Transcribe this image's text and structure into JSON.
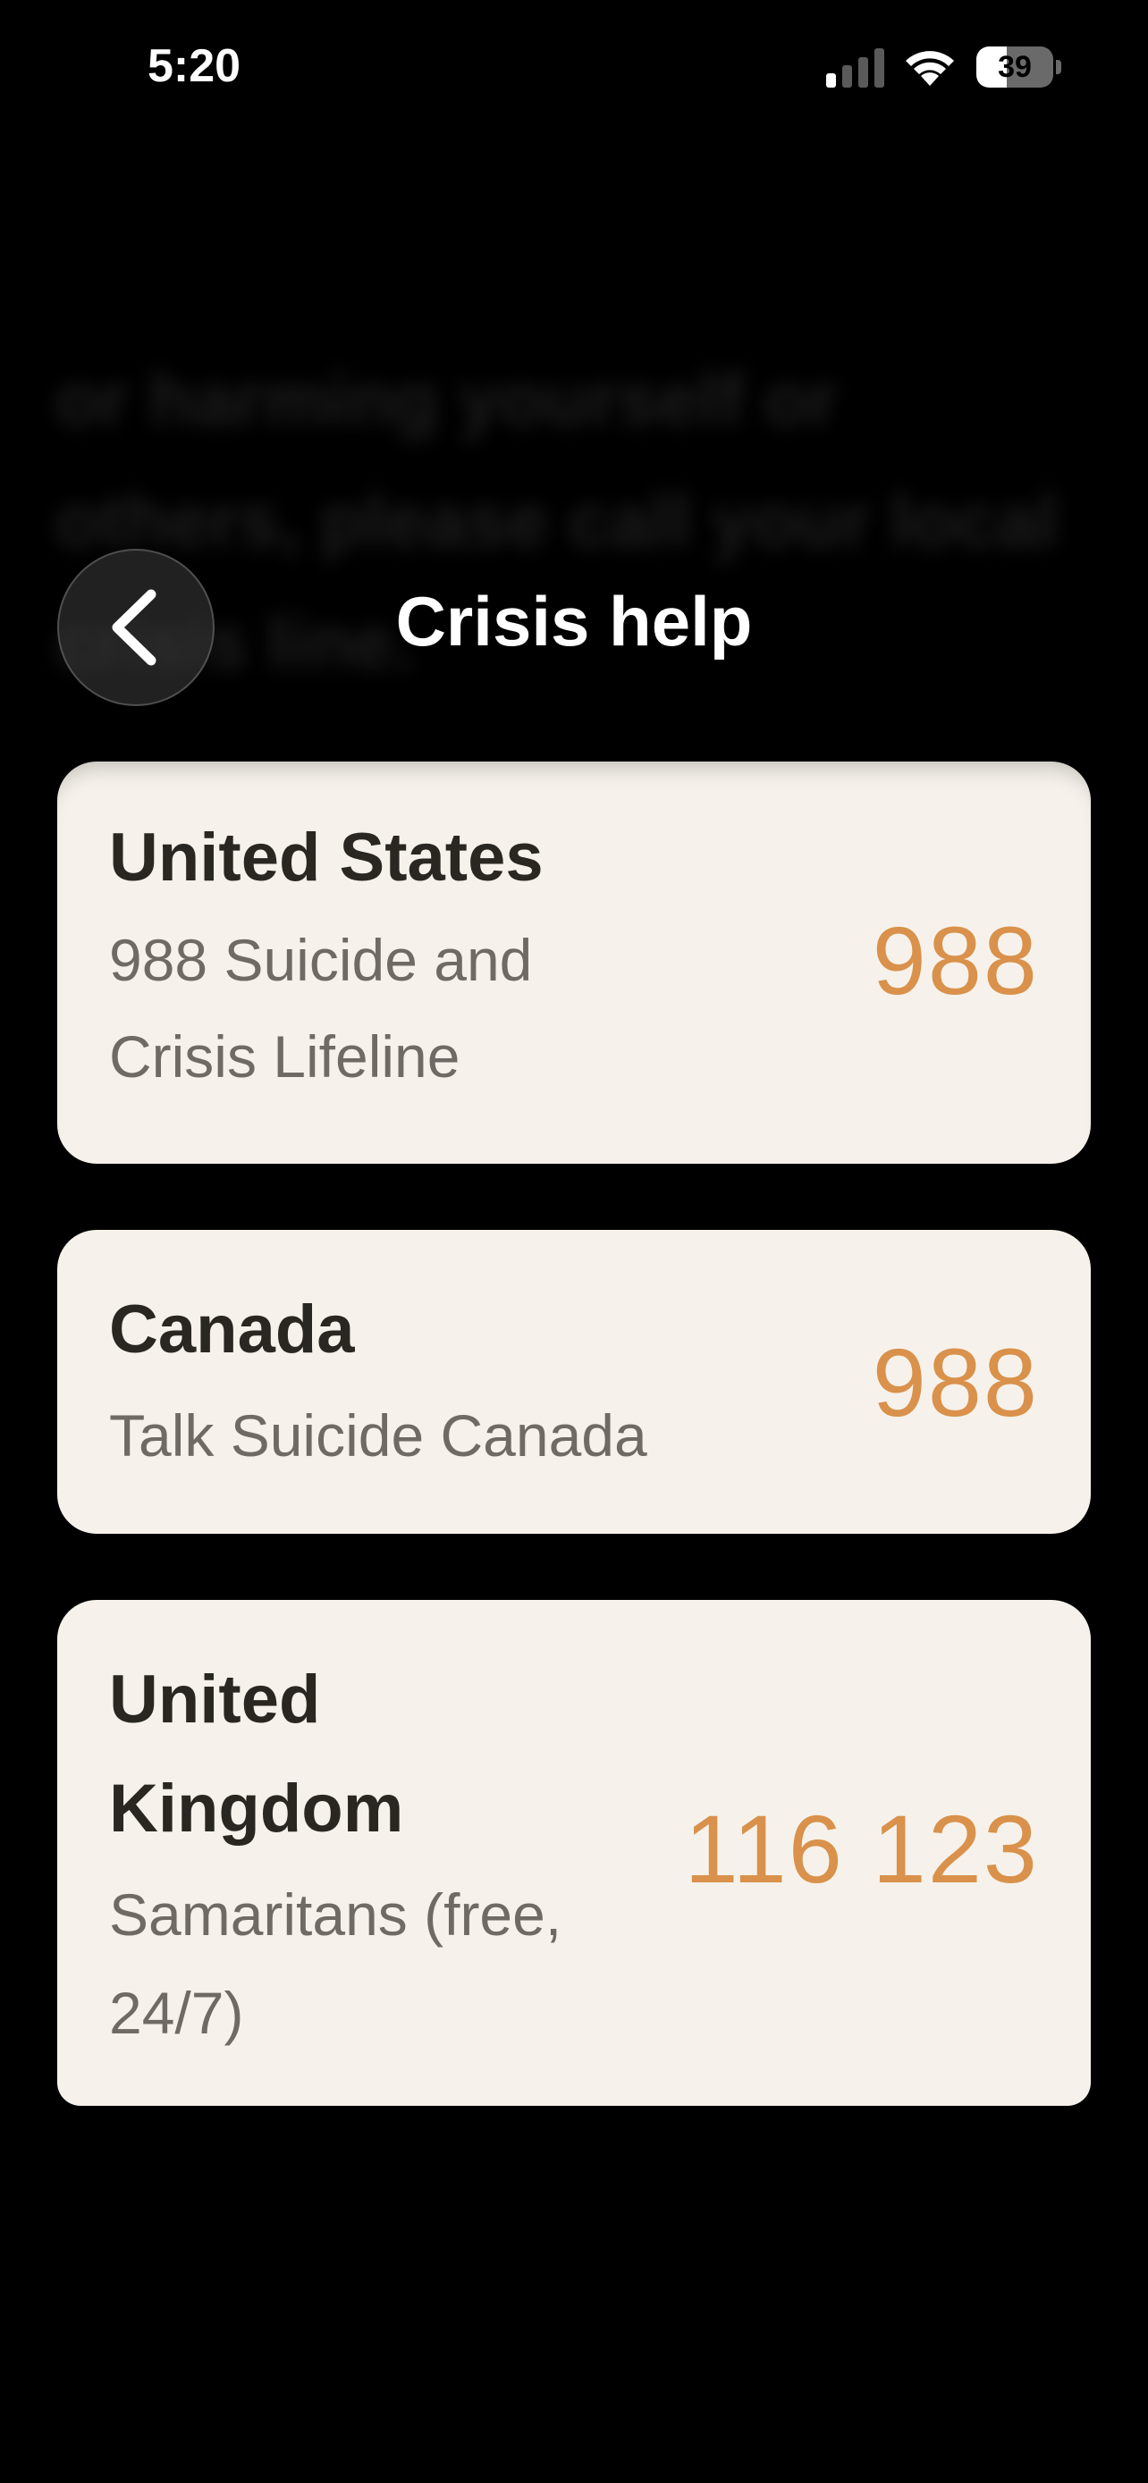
{
  "status_bar": {
    "time": "5:20",
    "battery_level": "39",
    "battery_fraction": 0.39
  },
  "background_text": {
    "line_1": "or harming yourself or",
    "line_2": "others, please call your local",
    "line_3": "crisis line."
  },
  "header": {
    "title": "Crisis help",
    "back_icon": "chevron-left-icon"
  },
  "hotlines": [
    {
      "country": "United States",
      "service_line_1": "988 Suicide and",
      "service_line_2": "Crisis Lifeline",
      "number": "988"
    },
    {
      "country": "Canada",
      "service_line_1": "Talk Suicide Canada",
      "number": "988"
    },
    {
      "country_line_1": "United",
      "country_line_2": "Kingdom",
      "service_line_1": "Samaritans (free,",
      "service_line_2": "24/7)",
      "number": "116 123"
    }
  ],
  "colors": {
    "background": "#000000",
    "card": "#f6f2eb",
    "number_accent": "#d9914b",
    "country_text": "#2a2622",
    "service_text": "#6f6a65"
  }
}
